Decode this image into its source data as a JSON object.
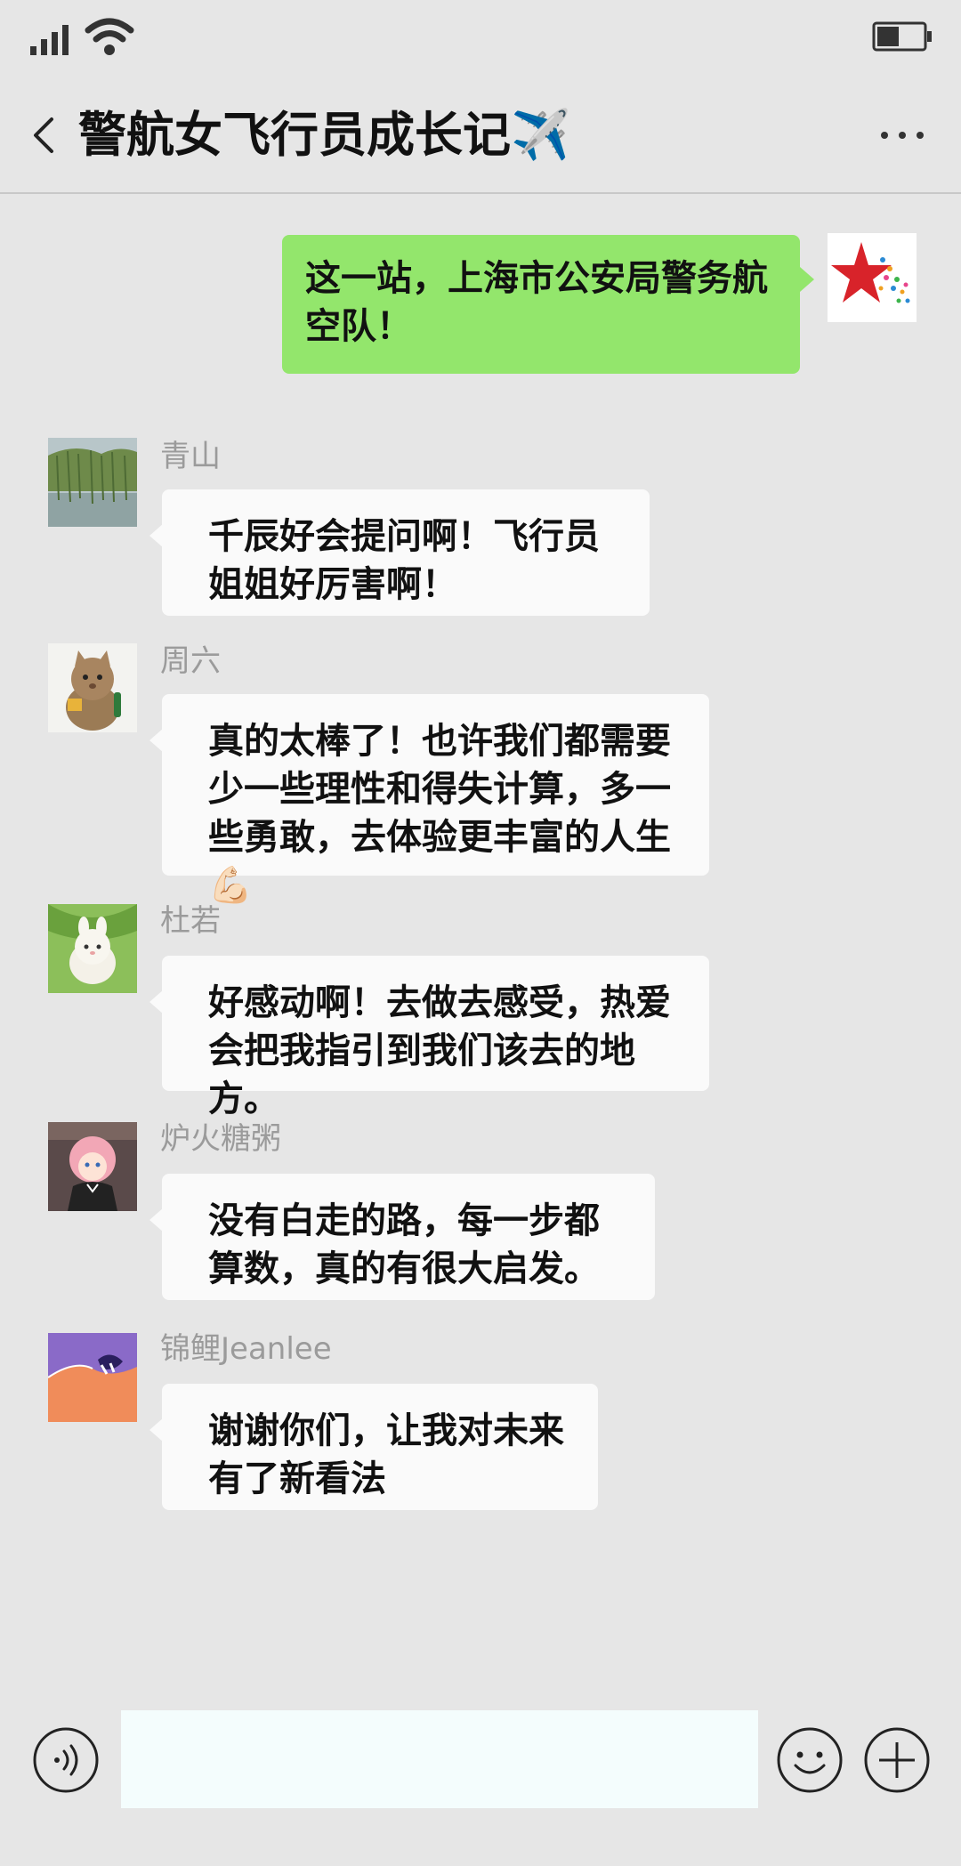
{
  "header": {
    "title": "警航女飞行员成长记✈️"
  },
  "messages": [
    {
      "direction": "outgoing",
      "text": "这一站，上海市公安局警务航空队！",
      "avatar_icon": "red-star-avatar-icon"
    },
    {
      "direction": "incoming",
      "sender": "青山",
      "text": "千辰好会提问啊！飞行员姐姐好厉害啊！",
      "avatar_icon": "willow-lake-avatar-icon"
    },
    {
      "direction": "incoming",
      "sender": "周六",
      "text": "真的太棒了！也许我们都需要少一些理性和得失计算，多一些勇敢，去体验更丰富的人生💪🏻",
      "avatar_icon": "cat-avatar-icon"
    },
    {
      "direction": "incoming",
      "sender": "杜若",
      "text": "好感动啊！去做去感受，热爱会把我指引到我们该去的地方。",
      "avatar_icon": "white-bunny-avatar-icon"
    },
    {
      "direction": "incoming",
      "sender": "炉火糖粥",
      "text": "没有白走的路，每一步都算数，真的有很大启发。",
      "avatar_icon": "anime-girl-avatar-icon"
    },
    {
      "direction": "incoming",
      "sender": "锦鲤Jeanlee",
      "text": "谢谢你们，让我对未来有了新看法",
      "avatar_icon": "purple-orange-avatar-icon"
    }
  ],
  "input": {
    "value": "",
    "placeholder": ""
  },
  "colors": {
    "background": "#e6e6e6",
    "outgoing_bubble": "#93e66c",
    "incoming_bubble": "#fafafa",
    "sender_name": "#9b9b9b"
  }
}
